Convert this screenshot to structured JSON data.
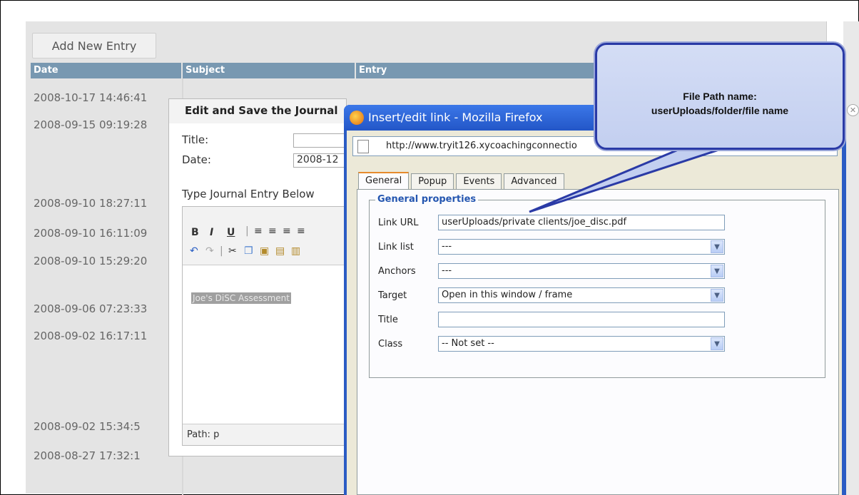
{
  "toolbar": {
    "add_label": "Add New Entry"
  },
  "table": {
    "headers": [
      "Date",
      "Subject",
      "Entry"
    ],
    "dates": [
      "2008-10-17 14:46:41",
      "2008-09-15 09:19:28",
      "2008-09-10 18:27:11",
      "2008-09-10 16:11:09",
      "2008-09-10 15:29:20",
      "2008-09-06 07:23:33",
      "2008-09-02 16:17:11",
      "2008-09-02 15:34:5",
      "2008-08-27 17:32:1"
    ]
  },
  "edit_dialog": {
    "title": "Edit and Save the Journal",
    "title_label": "Title:",
    "date_label": "Date:",
    "date_value": "2008-12",
    "prompt": "Type Journal Entry Below",
    "selected_text": "Joe's DiSC Assessment",
    "path": "Path: p",
    "tb_bold": "B",
    "tb_italic": "I",
    "tb_underline": "U"
  },
  "firefox": {
    "title": "Insert/edit link - Mozilla Firefox",
    "url": "http://www.tryit126.xycoachingconnectio",
    "tabs": [
      "General",
      "Popup",
      "Events",
      "Advanced"
    ],
    "legend": "General properties",
    "fields": {
      "link_url_label": "Link URL",
      "link_url_value": "userUploads/private clients/joe_disc.pdf",
      "link_list_label": "Link list",
      "link_list_value": "---",
      "anchors_label": "Anchors",
      "anchors_value": "---",
      "target_label": "Target",
      "target_value": "Open in this window / frame",
      "title_label": "Title",
      "title_value": "",
      "class_label": "Class",
      "class_value": "-- Not set --"
    }
  },
  "callout": {
    "line1": "File Path name:",
    "line2": "userUploads/folder/file name"
  },
  "colors": {
    "header_bg": "#7898b1",
    "callout_border": "#2a3aa6",
    "legend": "#2456b0",
    "firefox_frame": "#2b5cc4"
  }
}
